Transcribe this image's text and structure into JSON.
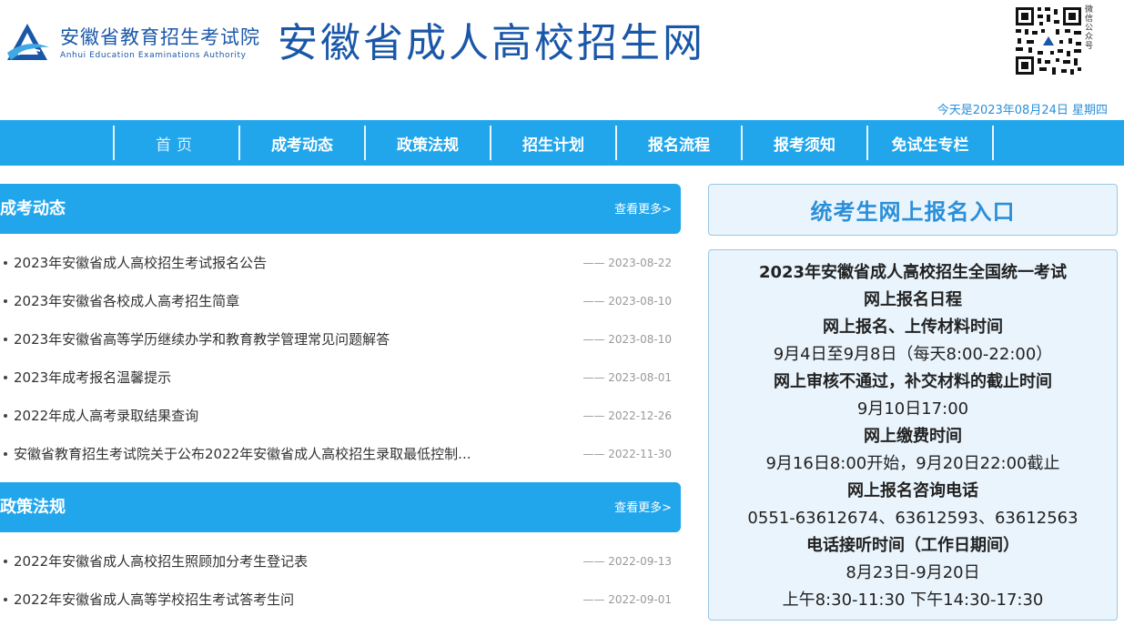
{
  "header": {
    "logo_cn": "安徽省教育招生考试院",
    "logo_en": "Anhui Education Examinations Authority",
    "site_title": "安徽省成人高校招生网",
    "qr_label": "微信公众号",
    "date_text": "今天是2023年08月24日 星期四"
  },
  "nav": {
    "items": [
      "首页",
      "成考动态",
      "政策法规",
      "招生计划",
      "报名流程",
      "报考须知",
      "免试生专栏"
    ]
  },
  "sections": [
    {
      "title": "成考动态",
      "more": "查看更多>",
      "items": [
        {
          "title": "2023年安徽省成人高校招生考试报名公告",
          "date": "—— 2023-08-22"
        },
        {
          "title": "2023年安徽省各校成人高考招生简章",
          "date": "—— 2023-08-10"
        },
        {
          "title": "2023年安徽省高等学历继续办学和教育教学管理常见问题解答",
          "date": "—— 2023-08-10"
        },
        {
          "title": "2023年成考报名温馨提示",
          "date": "—— 2023-08-01"
        },
        {
          "title": "2022年成人高考录取结果查询",
          "date": "—— 2022-12-26"
        },
        {
          "title": "安徽省教育招生考试院关于公布2022年安徽省成人高校招生录取最低控制...",
          "date": "—— 2022-11-30"
        }
      ]
    },
    {
      "title": "政策法规",
      "more": "查看更多>",
      "items": [
        {
          "title": "2022年安徽省成人高校招生照顾加分考生登记表",
          "date": "—— 2022-09-13"
        },
        {
          "title": "2022年安徽省成人高等学校招生考试答考生问",
          "date": "—— 2022-09-01"
        }
      ]
    }
  ],
  "right": {
    "entry": "统考生网上报名入口",
    "schedule": [
      {
        "text": "2023年安徽省成人高校招生全国统一考试",
        "bold": true
      },
      {
        "text": "网上报名日程",
        "bold": true
      },
      {
        "text": "网上报名、上传材料时间",
        "bold": true
      },
      {
        "text": "9月4日至9月8日（每天8:00-22:00）",
        "bold": false
      },
      {
        "text": "网上审核不通过，补交材料的截止时间",
        "bold": true
      },
      {
        "text": "9月10日17:00",
        "bold": false
      },
      {
        "text": "网上缴费时间",
        "bold": true
      },
      {
        "text": "9月16日8:00开始，9月20日22:00截止",
        "bold": false
      },
      {
        "text": "网上报名咨询电话",
        "bold": true
      },
      {
        "text": "0551-63612674、63612593、63612563",
        "bold": false
      },
      {
        "text": "电话接听时间（工作日期间）",
        "bold": true
      },
      {
        "text": "8月23日-9月20日",
        "bold": false
      },
      {
        "text": "上午8:30-11:30 下午14:30-17:30",
        "bold": false
      }
    ]
  },
  "colors": {
    "brand_blue": "#1a57a8",
    "nav_blue": "#21a6ec",
    "panel_bg": "#eaf4fc"
  },
  "icons": {
    "logo": "triangle-swoosh-logo-icon",
    "qr": "qr-code-icon"
  }
}
